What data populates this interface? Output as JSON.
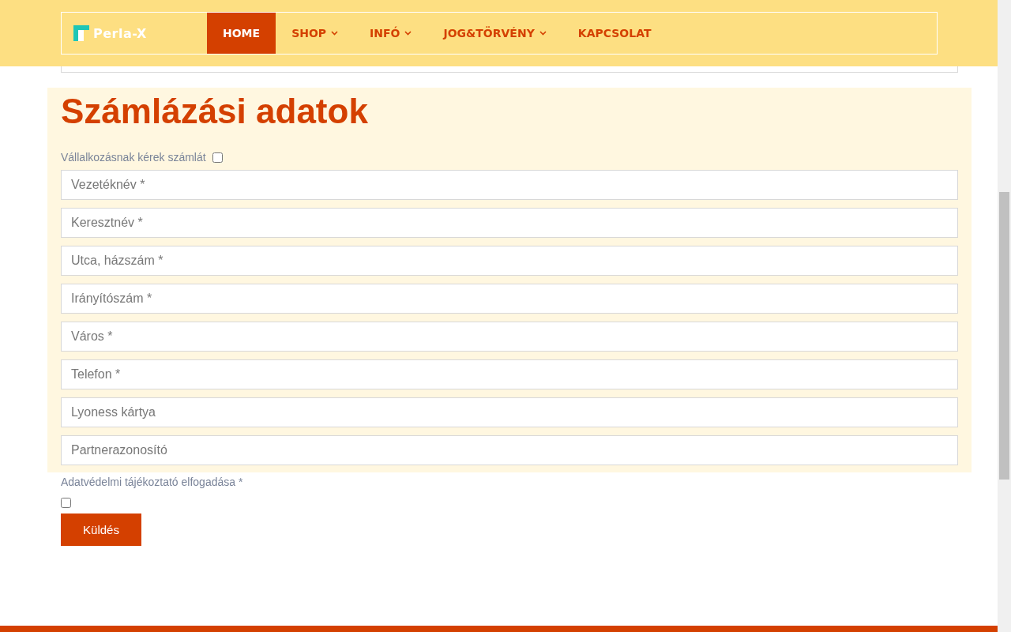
{
  "nav": {
    "logo": "Perla-X",
    "items": [
      {
        "label": "HOME",
        "selected": true,
        "dropdown": false
      },
      {
        "label": "SHOP",
        "selected": false,
        "dropdown": true
      },
      {
        "label": "INFÓ",
        "selected": false,
        "dropdown": true
      },
      {
        "label": "JOG&TÖRVÉNY",
        "selected": false,
        "dropdown": true
      },
      {
        "label": "KAPCSOLAT",
        "selected": false,
        "dropdown": false
      }
    ]
  },
  "billing": {
    "title": "Számlázási adatok",
    "company_invoice": {
      "label": "Vállalkozásnak kérek számlát",
      "checked": false
    },
    "fields": [
      {
        "placeholder": "Vezetéknév *"
      },
      {
        "placeholder": "Keresztnév *"
      },
      {
        "placeholder": "Utca, házszám *"
      },
      {
        "placeholder": "Irányítószám *"
      },
      {
        "placeholder": "Város *"
      },
      {
        "placeholder": "Telefon *"
      },
      {
        "placeholder": "Lyoness kártya"
      },
      {
        "placeholder": "Partnerazonosító"
      }
    ]
  },
  "privacy": {
    "label": "Adatvédelmi tájékoztató elfogadása *",
    "checked": false
  },
  "submit": "Küldés"
}
